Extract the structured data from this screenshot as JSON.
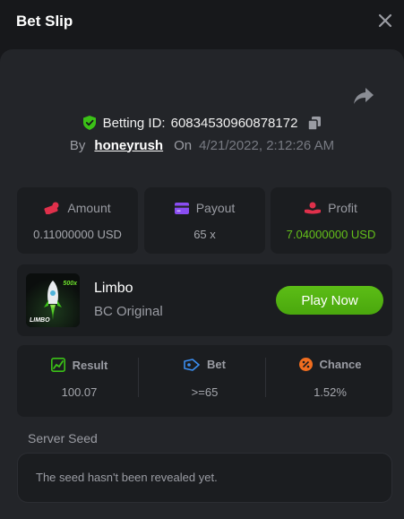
{
  "header": {
    "title": "Bet Slip"
  },
  "bet": {
    "id_label": "Betting ID:",
    "id_value": "6083453096087817​2",
    "by_label": "By",
    "user": "honeyrush",
    "on_label": "On",
    "date": "4/21/2022, 2:12:26 AM"
  },
  "stats": [
    {
      "label": "Amount",
      "value": "0.11000000 USD",
      "icon": "coin-icon"
    },
    {
      "label": "Payout",
      "value": "65 x",
      "icon": "card-icon"
    },
    {
      "label": "Profit",
      "value": "7.04000000 USD",
      "icon": "hand-coin-icon"
    }
  ],
  "game": {
    "name": "Limbo",
    "subtitle": "BC Original",
    "thumb_text": "LIMBO",
    "thumb_badge": "500x",
    "play_label": "Play Now"
  },
  "result": [
    {
      "label": "Result",
      "value": "100.07",
      "icon": "chart-icon"
    },
    {
      "label": "Bet",
      "value": ">=65",
      "icon": "ticket-icon"
    },
    {
      "label": "Chance",
      "value": "1.52%",
      "icon": "percent-icon"
    }
  ],
  "seed": {
    "label": "Server Seed",
    "text": "The seed hasn't been revealed yet."
  },
  "colors": {
    "accent_green": "#5cbd16",
    "profit_green": "#64c01a",
    "bg": "#17181b",
    "panel": "#232529"
  }
}
